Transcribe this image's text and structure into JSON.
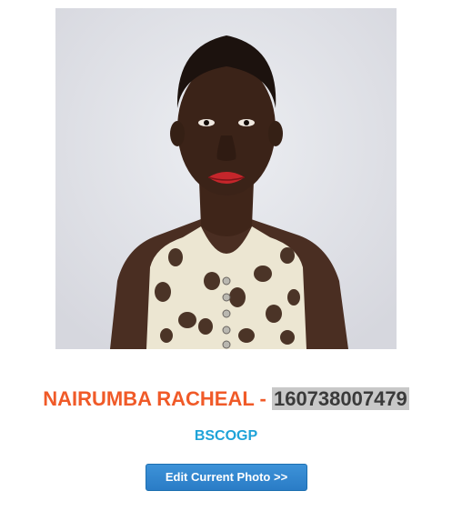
{
  "profile": {
    "photo_icon": "portrait-photo",
    "name": "NAIRUMBA RACHEAL",
    "separator": " - ",
    "student_id": "160738007479",
    "program": "BSCOGP"
  },
  "actions": {
    "edit_photo_label": "Edit Current Photo >>"
  },
  "colors": {
    "name": "#f05a28",
    "id_highlight": "#c8c8c8",
    "program": "#1fa3d8",
    "button": "#2a7cc6"
  }
}
